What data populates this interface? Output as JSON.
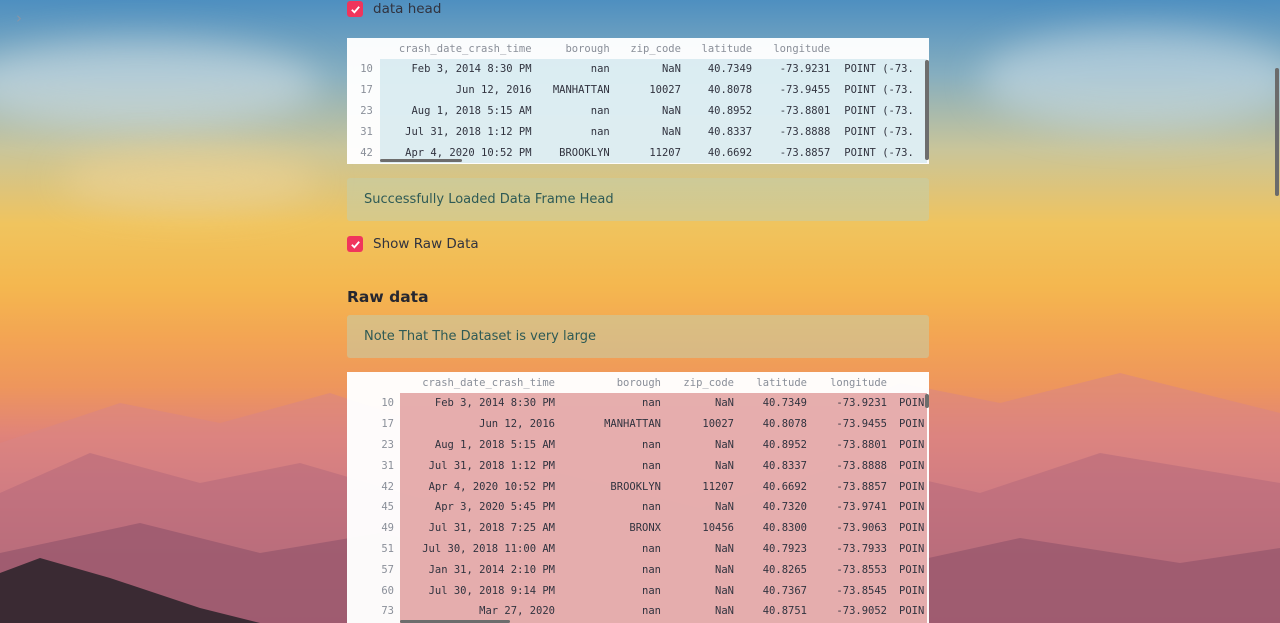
{
  "sidebar": {
    "toggle_icon": "chevron-right-icon",
    "toggle_glyph": "›"
  },
  "checkboxes": {
    "data_head": {
      "label": "data head",
      "checked": true
    },
    "show_raw": {
      "label": "Show Raw Data",
      "checked": true
    }
  },
  "alerts": {
    "loaded": "Successfully Loaded Data Frame Head",
    "note": "Note That The Dataset is very large"
  },
  "raw_header": "Raw data",
  "colors": {
    "accent": "#f0355c",
    "alert_text": "#2e5a55"
  },
  "head_table": {
    "columns": [
      "",
      "crash_date_crash_time",
      "borough",
      "zip_code",
      "latitude",
      "longitude",
      ""
    ],
    "rows": [
      [
        "10",
        "Feb 3, 2014 8:30 PM",
        "nan",
        "NaN",
        "40.7349",
        "-73.9231",
        "POINT (-73."
      ],
      [
        "17",
        "Jun 12, 2016",
        "MANHATTAN",
        "10027",
        "40.8078",
        "-73.9455",
        "POINT (-73."
      ],
      [
        "23",
        "Aug 1, 2018 5:15 AM",
        "nan",
        "NaN",
        "40.8952",
        "-73.8801",
        "POINT (-73."
      ],
      [
        "31",
        "Jul 31, 2018 1:12 PM",
        "nan",
        "NaN",
        "40.8337",
        "-73.8888",
        "POINT (-73."
      ],
      [
        "42",
        "Apr 4, 2020 10:52 PM",
        "BROOKLYN",
        "11207",
        "40.6692",
        "-73.8857",
        "POINT (-73."
      ]
    ]
  },
  "raw_table": {
    "columns": [
      "",
      "crash_date_crash_time",
      "borough",
      "zip_code",
      "latitude",
      "longitude",
      ""
    ],
    "rows": [
      [
        "10",
        "Feb 3, 2014 8:30 PM",
        "nan",
        "NaN",
        "40.7349",
        "-73.9231",
        "POIN"
      ],
      [
        "17",
        "Jun 12, 2016",
        "MANHATTAN",
        "10027",
        "40.8078",
        "-73.9455",
        "POIN"
      ],
      [
        "23",
        "Aug 1, 2018 5:15 AM",
        "nan",
        "NaN",
        "40.8952",
        "-73.8801",
        "POIN"
      ],
      [
        "31",
        "Jul 31, 2018 1:12 PM",
        "nan",
        "NaN",
        "40.8337",
        "-73.8888",
        "POIN"
      ],
      [
        "42",
        "Apr 4, 2020 10:52 PM",
        "BROOKLYN",
        "11207",
        "40.6692",
        "-73.8857",
        "POIN"
      ],
      [
        "45",
        "Apr 3, 2020 5:45 PM",
        "nan",
        "NaN",
        "40.7320",
        "-73.9741",
        "POIN"
      ],
      [
        "49",
        "Jul 31, 2018 7:25 AM",
        "BRONX",
        "10456",
        "40.8300",
        "-73.9063",
        "POIN"
      ],
      [
        "51",
        "Jul 30, 2018 11:00 AM",
        "nan",
        "NaN",
        "40.7923",
        "-73.7933",
        "POIN"
      ],
      [
        "57",
        "Jan 31, 2014 2:10 PM",
        "nan",
        "NaN",
        "40.8265",
        "-73.8553",
        "POIN"
      ],
      [
        "60",
        "Jul 30, 2018 9:14 PM",
        "nan",
        "NaN",
        "40.7367",
        "-73.8545",
        "POIN"
      ],
      [
        "73",
        "Mar 27, 2020",
        "nan",
        "NaN",
        "40.8751",
        "-73.9052",
        "POIN"
      ]
    ]
  }
}
